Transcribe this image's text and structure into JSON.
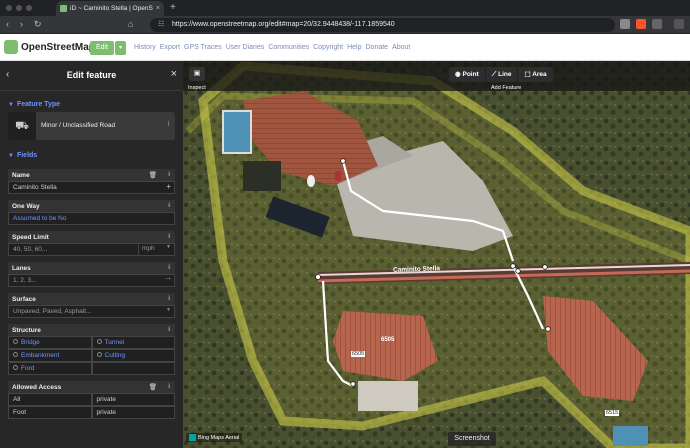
{
  "browser": {
    "tab_title": "iD ~ Caminito Stella | OpenStreetMap",
    "tab_close": "×",
    "new_tab": "+",
    "back": "‹",
    "forward": "›",
    "reload": "↻",
    "home": "⌂",
    "url": "https://www.openstreetmap.org/edit#map=20/32.9448438/-117.1859540"
  },
  "osm_header": {
    "brand": "OpenStreetMap",
    "edit_label": "Edit",
    "edit_caret": "▾",
    "nav": [
      "History",
      "Export",
      "GPS Traces",
      "User Diaries",
      "Communities",
      "Copyright",
      "Help",
      "Donate",
      "About"
    ]
  },
  "sidebar": {
    "title": "Edit feature",
    "back": "‹",
    "close": "×",
    "feature_type_heading": "Feature Type",
    "feature_type": "Minor / Unclassified Road",
    "fields_heading": "Fields",
    "name_label": "Name",
    "name_value": "Caminito Stella",
    "oneway_label": "One Way",
    "oneway_value": "Assumed to be No",
    "speed_label": "Speed Limit",
    "speed_placeholder": "40, 50, 60...",
    "speed_unit": "mph",
    "lanes_label": "Lanes",
    "lanes_placeholder": "1, 2, 3...",
    "surface_label": "Surface",
    "surface_placeholder": "Unpaved, Paved, Asphalt...",
    "structure_label": "Structure",
    "structure_options": [
      "Bridge",
      "Tunnel",
      "Embankment",
      "Cutting",
      "Ford"
    ],
    "access_label": "Allowed Access",
    "access_rows": [
      {
        "key": "All",
        "value": "private"
      },
      {
        "key": "Foot",
        "value": "private"
      }
    ]
  },
  "map": {
    "inspect_label": "Inspect",
    "modes": [
      "Point",
      "Line",
      "Area"
    ],
    "add_feature_label": "Add Feature",
    "road_label": "Caminito Stella",
    "house_numbers": [
      "6505",
      "6505",
      "6515"
    ],
    "attribution": "Bing Maps Aerial",
    "screenshot_tag": "Screenshot"
  },
  "colors": {
    "accent": "#7092ff",
    "osm_green": "#7ebc6f",
    "area_fill": "#d7d44a"
  }
}
